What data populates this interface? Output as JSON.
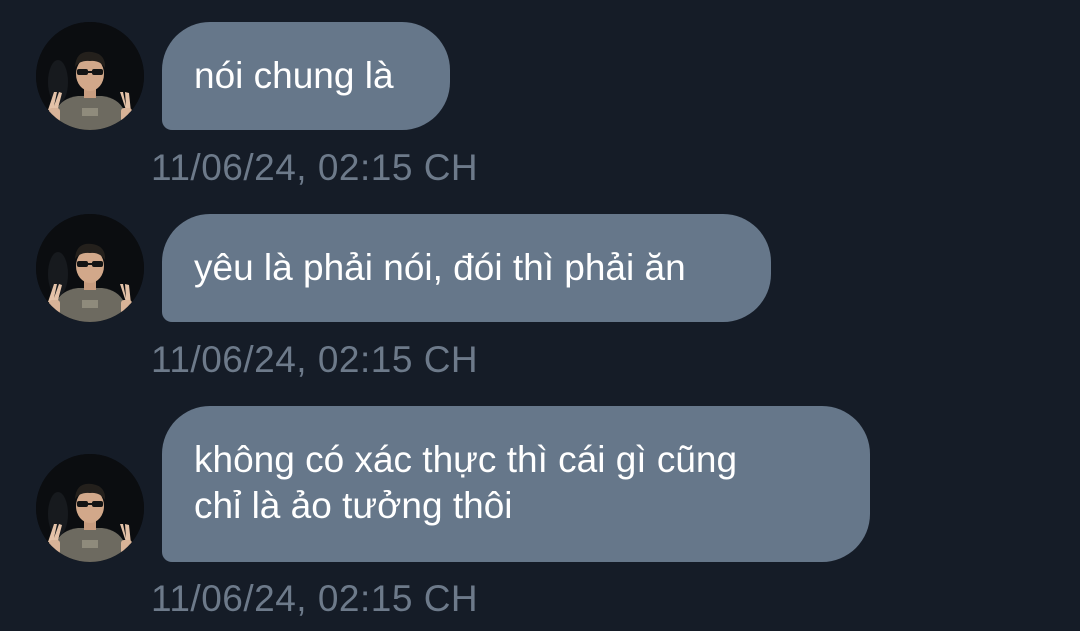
{
  "messages": [
    {
      "text": "nói chung là",
      "timestamp": "11/06/24, 02:15 CH",
      "avatar_icon": "user-avatar-peace-sign"
    },
    {
      "text": "yêu là phải nói, đói thì phải ăn",
      "timestamp": "11/06/24, 02:15 CH",
      "avatar_icon": "user-avatar-peace-sign"
    },
    {
      "text": "không có xác thực thì cái gì cũng\nchỉ là ảo tưởng thôi",
      "timestamp": "11/06/24, 02:15 CH",
      "avatar_icon": "user-avatar-peace-sign"
    }
  ],
  "colors": {
    "background": "#151c27",
    "bubble": "#66778a",
    "bubble_text": "#ffffff",
    "timestamp": "#6d7a8a"
  }
}
